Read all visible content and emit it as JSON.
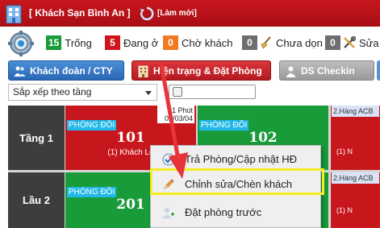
{
  "header": {
    "title": "[ Khách Sạn Bình An ]",
    "refresh_label": "[Làm mới]"
  },
  "stats": [
    {
      "count": "15",
      "label": "Trống",
      "color": "#1a9b3a",
      "icon": "none"
    },
    {
      "count": "5",
      "label": "Đang ở",
      "color": "#d0161c",
      "icon": "none"
    },
    {
      "count": "0",
      "label": "Chờ khách",
      "color": "#f07a22",
      "icon": "none"
    },
    {
      "count": "0",
      "label": "Chưa dọn",
      "color": "#6e6e6e",
      "icon": "broom-icon"
    },
    {
      "count": "0",
      "label": "Sửa",
      "color": "#6e6e6e",
      "icon": "tools-icon"
    }
  ],
  "toolbar": {
    "group_label": "Khách đoàn / CTY",
    "status_label": "Hiện trạng & Đặt Phòng",
    "checkin_label": "DS Checkin"
  },
  "sort": {
    "selected": "Sắp xếp theo tầng"
  },
  "floors": [
    {
      "label": "Tầng 1"
    },
    {
      "label": "Lầu 2"
    }
  ],
  "rooms": [
    {
      "type": "PHÒNG ĐÔI",
      "number": "101",
      "status": "occupied",
      "sub": "(1) Khách Lẻ",
      "time_line1": "1 Phút",
      "time_line2": "02/03/04"
    },
    {
      "type": "PHÒNG ĐÔI",
      "number": "102",
      "status": "vacant"
    },
    {
      "type": "PHÒNG ĐÔI",
      "number": "201",
      "status": "vacant"
    }
  ],
  "side_rooms": [
    {
      "head": "2.Hàng ACB",
      "sub": "(1) N"
    },
    {
      "head": "2.Hàng ACB",
      "sub": "(1) N"
    }
  ],
  "context_menu": {
    "items": [
      {
        "label": "Trả Phòng/Cập nhật HĐ",
        "icon": "checkout-icon"
      },
      {
        "label": "Chỉnh sửa/Chèn khách",
        "icon": "pencil-icon",
        "highlighted": true
      },
      {
        "label": "Đặt phòng trước",
        "icon": "add-user-icon"
      }
    ]
  },
  "colors": {
    "header_red": "#c8161d",
    "occupied_red": "#c8161d",
    "vacant_green": "#1a9b3a",
    "floor_dark": "#3d3d3d",
    "type_badge": "#21b8e8",
    "highlight_yellow": "#f4ee21",
    "arrow_red": "#e8333a"
  }
}
